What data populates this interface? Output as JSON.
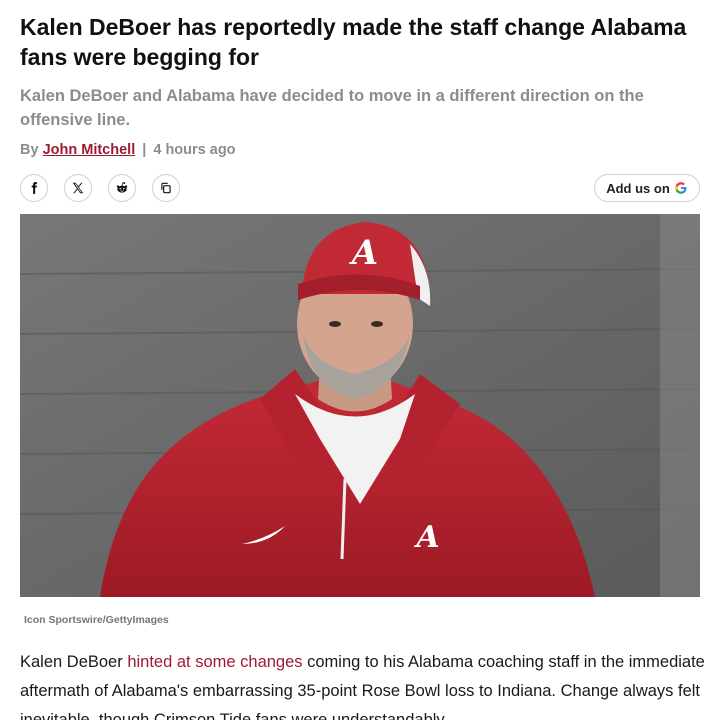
{
  "article": {
    "headline": "Kalen DeBoer has reportedly made the staff change Alabama fans were begging for",
    "subheadline": "Kalen DeBoer and Alabama have decided to move in a different direction on the offensive line.",
    "byline_prefix": "By",
    "author": "John Mitchell",
    "separator": "|",
    "timestamp": "4 hours ago"
  },
  "share": {
    "buttons": [
      {
        "icon": "facebook-icon"
      },
      {
        "icon": "x-icon"
      },
      {
        "icon": "reddit-icon"
      },
      {
        "icon": "copy-link-icon"
      }
    ],
    "add_us_label": "Add us on",
    "add_us_icon": "google-icon"
  },
  "hero": {
    "cap_logo": "A",
    "credit": "Icon Sportswire/GettyImages",
    "colors": {
      "crimson": "#b51e2d",
      "background": "#6e6e6e"
    }
  },
  "body": {
    "p1_start": "Kalen DeBoer ",
    "p1_link": "hinted at some changes",
    "p1_rest": " coming to his Alabama coaching staff in the immediate aftermath of Alabama's embarrassing 35-point Rose Bowl loss to Indiana. Change always felt inevitable, though Crimson Tide fans were understandably"
  },
  "colors": {
    "link": "#9e1b32",
    "muted": "#8c8c8c"
  }
}
